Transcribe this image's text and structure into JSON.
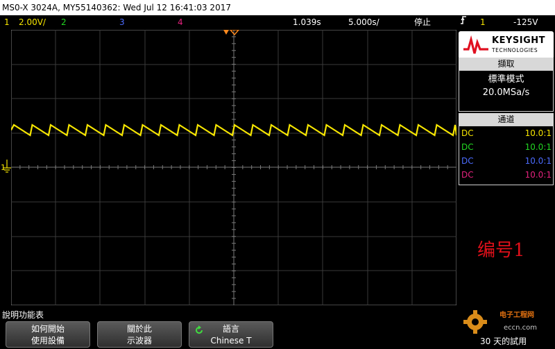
{
  "title": "MS0-X 3024A, MY55140362: Wed Jul 12 16:41:03 2017",
  "status": {
    "ch1_label": "1",
    "ch1_scale": "2.00V/",
    "ch2_label": "2",
    "ch3_label": "3",
    "ch4_label": "4",
    "time_offset": "1.039s",
    "timebase": "5.000s/",
    "run_state": "停止",
    "trigger_channel": "1",
    "trigger_level": "-125V"
  },
  "logo": {
    "brand": "KEYSIGHT",
    "sub": "TECHNOLOGIES"
  },
  "acquisition": {
    "header": "擷取",
    "mode": "標準模式",
    "rate": "20.0MSa/s"
  },
  "channels": {
    "header": "通道",
    "rows": [
      {
        "coupling": "DC",
        "probe": "10.0:1",
        "color": "#f7e600"
      },
      {
        "coupling": "DC",
        "probe": "10.0:1",
        "color": "#22d722"
      },
      {
        "coupling": "DC",
        "probe": "10.0:1",
        "color": "#4c6cff"
      },
      {
        "coupling": "DC",
        "probe": "10.0:1",
        "color": "#e5227e"
      }
    ]
  },
  "annotation": "编号1",
  "ground_marker": "1",
  "softkeys": {
    "menu_title": "說明功能表",
    "keys": [
      {
        "line1": "如何開始",
        "line2": "使用設備"
      },
      {
        "line1": "關於此",
        "line2": "示波器"
      },
      {
        "line1": "語言",
        "line2": "Chinese T"
      }
    ]
  },
  "watermark": {
    "site": "电子工程网",
    "url": "eccn.com",
    "bottom": "30 天的試用"
  },
  "colors": {
    "ch1": "#f7e600",
    "ch2": "#22d722",
    "ch3": "#4c6cff",
    "ch4": "#e5227e",
    "trigger": "#ff8a1e"
  }
}
